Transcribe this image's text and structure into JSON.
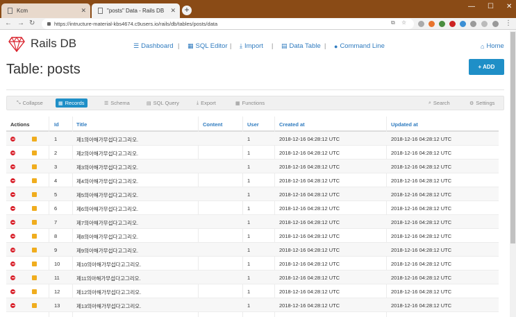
{
  "browser": {
    "tabs": [
      {
        "title": "Kcm",
        "active": false
      },
      {
        "title": "\"posts\" Data - Rails DB",
        "active": true
      }
    ],
    "url": "https://intructure-material-kbs4674.c9users.io/rails/db/tables/posts/data"
  },
  "app": {
    "brand": "Rails DB",
    "brand_color": "#d9232d",
    "nav": [
      {
        "label": "Dashboard",
        "icon": "list-icon"
      },
      {
        "label": "SQL Editor",
        "icon": "table-icon"
      },
      {
        "label": "Import",
        "icon": "download-icon"
      },
      {
        "label": "Data Table",
        "icon": "grid-icon"
      },
      {
        "label": "Command Line",
        "icon": "circle-icon"
      }
    ],
    "home": "Home",
    "page_title": "Table: posts",
    "add_button": "+ ADD",
    "accent": "#1f8fc7"
  },
  "subnav": {
    "left": [
      {
        "label": "Collapse",
        "active": false
      },
      {
        "label": "Records",
        "active": true
      },
      {
        "label": "Schema",
        "active": false
      },
      {
        "label": "SQL Query",
        "active": false
      },
      {
        "label": "Export",
        "active": false
      },
      {
        "label": "Functions",
        "active": false
      }
    ],
    "right": [
      {
        "label": "Search"
      },
      {
        "label": "Settings"
      }
    ]
  },
  "table": {
    "columns": [
      "Actions",
      "Id",
      "Title",
      "Content",
      "User",
      "Created at",
      "Updated at"
    ],
    "rows": [
      {
        "id": "1",
        "title": "제1의아해가무섭다고그리오.",
        "content": "",
        "user": "1",
        "created": "2018-12-16 04:28:12 UTC",
        "updated": "2018-12-16 04:28:12 UTC"
      },
      {
        "id": "2",
        "title": "제2의아해가무섭다고그리오.",
        "content": "",
        "user": "1",
        "created": "2018-12-16 04:28:12 UTC",
        "updated": "2018-12-16 04:28:12 UTC"
      },
      {
        "id": "3",
        "title": "제3의아해가무섭다고그리오.",
        "content": "",
        "user": "1",
        "created": "2018-12-16 04:28:12 UTC",
        "updated": "2018-12-16 04:28:12 UTC"
      },
      {
        "id": "4",
        "title": "제4의아해가무섭다고그리오.",
        "content": "",
        "user": "1",
        "created": "2018-12-16 04:28:12 UTC",
        "updated": "2018-12-16 04:28:12 UTC"
      },
      {
        "id": "5",
        "title": "제5의아해가무섭다고그리오.",
        "content": "",
        "user": "1",
        "created": "2018-12-16 04:28:12 UTC",
        "updated": "2018-12-16 04:28:12 UTC"
      },
      {
        "id": "6",
        "title": "제6의아해가무섭다고그리오.",
        "content": "",
        "user": "1",
        "created": "2018-12-16 04:28:12 UTC",
        "updated": "2018-12-16 04:28:12 UTC"
      },
      {
        "id": "7",
        "title": "제7의아해가무섭다고그리오.",
        "content": "",
        "user": "1",
        "created": "2018-12-16 04:28:12 UTC",
        "updated": "2018-12-16 04:28:12 UTC"
      },
      {
        "id": "8",
        "title": "제8의아해가무섭다고그리오.",
        "content": "",
        "user": "1",
        "created": "2018-12-16 04:28:12 UTC",
        "updated": "2018-12-16 04:28:12 UTC"
      },
      {
        "id": "9",
        "title": "제9의아해가무섭다고그리오.",
        "content": "",
        "user": "1",
        "created": "2018-12-16 04:28:12 UTC",
        "updated": "2018-12-16 04:28:12 UTC"
      },
      {
        "id": "10",
        "title": "제10의아해가무섭다고그리오.",
        "content": "",
        "user": "1",
        "created": "2018-12-16 04:28:12 UTC",
        "updated": "2018-12-16 04:28:12 UTC"
      },
      {
        "id": "11",
        "title": "제11의아해가무섭다고그리오.",
        "content": "",
        "user": "1",
        "created": "2018-12-16 04:28:12 UTC",
        "updated": "2018-12-16 04:28:12 UTC"
      },
      {
        "id": "12",
        "title": "제12의아해가무섭다고그리오.",
        "content": "",
        "user": "1",
        "created": "2018-12-16 04:28:12 UTC",
        "updated": "2018-12-16 04:28:12 UTC"
      },
      {
        "id": "13",
        "title": "제13의아해가무섭다고그리오.",
        "content": "",
        "user": "1",
        "created": "2018-12-16 04:28:12 UTC",
        "updated": "2018-12-16 04:28:12 UTC"
      }
    ]
  }
}
